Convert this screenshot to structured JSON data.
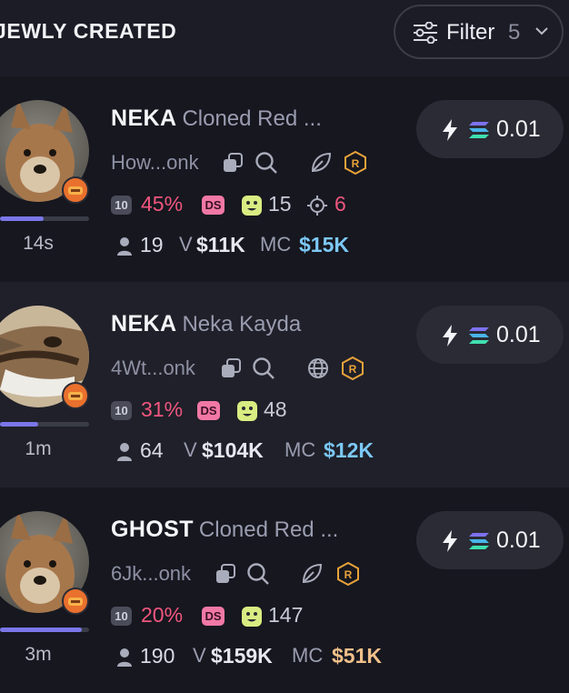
{
  "header": {
    "title": "JEWLY CREATED",
    "filter_label": "Filter",
    "filter_count": "5",
    "filter_icon": "sliders-icon",
    "chevron_icon": "chevron-down-icon"
  },
  "colors": {
    "background": "#16171f",
    "row_alt": "#1f2029",
    "accent_pink": "#f0567e",
    "accent_blue": "#7cc8f5",
    "accent_gold": "#f0c08a",
    "progress": "#7b76e8"
  },
  "cards": [
    {
      "ticker": "NEKA",
      "name": "Cloned Red ...",
      "address": "How...onk",
      "age": "14s",
      "progress_pct": 49,
      "top10_label": "10",
      "top10_pct": "45%",
      "ds_label": "DS",
      "smiley_count": "15",
      "snipers": "6",
      "holders": "19",
      "volume_label": "V",
      "volume": "$11K",
      "mc_label": "MC",
      "mc": "$15K",
      "mc_color": "#7cc8f5",
      "buy_amount": "0.01",
      "social_icon": "leaf-icon",
      "platform_icon": "raydium-icon"
    },
    {
      "ticker": "NEKA",
      "name": "Neka Kayda",
      "address": "4Wt...onk",
      "age": "1m",
      "progress_pct": 43,
      "top10_label": "10",
      "top10_pct": "31%",
      "ds_label": "DS",
      "smiley_count": "48",
      "snipers": "",
      "holders": "64",
      "volume_label": "V",
      "volume": "$104K",
      "mc_label": "MC",
      "mc": "$12K",
      "mc_color": "#7cc8f5",
      "buy_amount": "0.01",
      "social_icon": "globe-icon",
      "platform_icon": "raydium-icon"
    },
    {
      "ticker": "GHOST",
      "name": "Cloned Red ...",
      "address": "6Jk...onk",
      "age": "3m",
      "progress_pct": 92,
      "top10_label": "10",
      "top10_pct": "20%",
      "ds_label": "DS",
      "smiley_count": "147",
      "snipers": "",
      "holders": "190",
      "volume_label": "V",
      "volume": "$159K",
      "mc_label": "MC",
      "mc": "$51K",
      "mc_color": "#f0c08a",
      "buy_amount": "0.01",
      "social_icon": "leaf-icon",
      "platform_icon": "raydium-icon"
    }
  ]
}
